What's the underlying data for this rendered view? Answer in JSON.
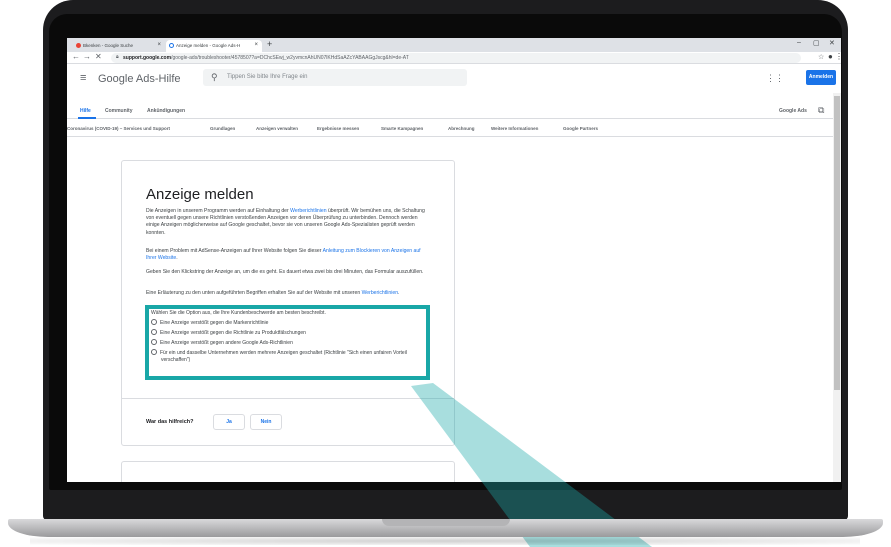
{
  "colors": {
    "accent": "#1a73e8",
    "highlight": "#19a7a7"
  },
  "browser": {
    "tabs": [
      {
        "label": "Bkenken - Google Suche",
        "icon": "google-g-icon"
      },
      {
        "label": "Anzeige melden - Google Ads-H",
        "icon": "google-ads-icon"
      }
    ],
    "url_domain": "support.google.com",
    "url_path": "/google-ads/troubleshooter/4578507?a=DChcSEwj_w2yvmcnAhUN07lKHdSaAZcYABAAGgJscg&hl=de-AT"
  },
  "header": {
    "brand": "Google Ads-Hilfe",
    "search_placeholder": "Tippen Sie bitte Ihre Frage ein",
    "signin": "Anmelden"
  },
  "top_tabs": [
    {
      "label": "Hilfe",
      "active": true
    },
    {
      "label": "Community",
      "active": false
    },
    {
      "label": "Ankündigungen",
      "active": false
    }
  ],
  "product_link": "Google Ads",
  "categories": [
    "Coronavirus (COVID-19) – Services und Support",
    "Grundlagen",
    "Anzeigen verwalten",
    "Ergebnisse messen",
    "Smarte Kampagnen",
    "Abrechnung",
    "Weitere Informationen",
    "Google Partners"
  ],
  "article": {
    "title": "Anzeige melden",
    "p1_a": "Die Anzeigen in unserem Programm werden auf Einhaltung der ",
    "p1_link": "Werberichtlinien",
    "p1_b": " überprüft. Wir bemühen uns, die Schaltung von eventuell gegen unsere Richtlinien verstoßenden Anzeigen vor deren Überprüfung zu unterbinden. Dennoch werden einige Anzeigen möglicherweise auf Google geschaltet, bevor sie von unseren Google Ads-Spezialisten geprüft werden konnten.",
    "p2_a": "Bei einem Problem mit AdSense-Anzeigen auf Ihrer Website folgen Sie dieser ",
    "p2_link": "Anleitung zum Blockieren von Anzeigen auf Ihrer Website",
    "p2_b": ".",
    "p3": "Geben Sie den Klickstring der Anzeige an, um die es geht. Es dauert etwa zwei bis drei Minuten, das Formular auszufüllen.",
    "p4_a": "Eine Erläuterung zu den unten aufgeführten Begriffen erhalten Sie auf der Website mit unseren ",
    "p4_link": "Werberichtlinien",
    "p4_b": ".",
    "question": "Wählen Sie die Option aus, die Ihre Kundenbeschwerde am besten beschreibt.",
    "options": [
      "Eine Anzeige verstößt gegen die Markenrichtlinie",
      "Eine Anzeige verstößt gegen die Richtlinie zu Produktfälschungen",
      "Eine Anzeige verstößt gegen andere Google Ads-Richtlinien",
      "Für ein und dasselbe Unternehmen werden mehrere Anzeigen geschaltet (Richtlinie \"Sich einen unfairen Vorteil verschaffen\")"
    ]
  },
  "feedback": {
    "question": "War das hilfreich?",
    "yes": "Ja",
    "no": "Nein"
  }
}
